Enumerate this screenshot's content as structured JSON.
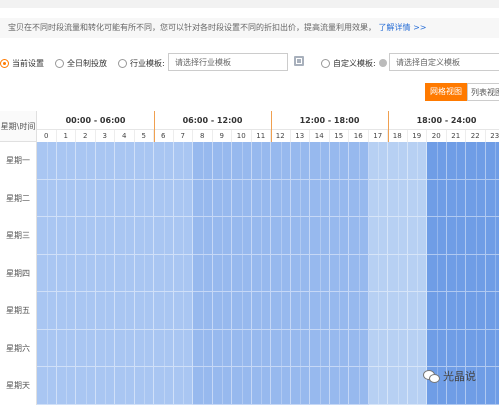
{
  "notice": {
    "text": "宝贝在不同时段流量和转化可能有所不同，您可以针对各时段设置不同的折扣出价，提高流量利用效果，",
    "link": "了解详情 >>"
  },
  "options": {
    "current": "当前设置",
    "full_day": "全日制投放",
    "industry": "行业模板:",
    "industry_placeholder": "请选择行业模板",
    "custom": "自定义模板:",
    "custom_placeholder": "请选择自定义模板",
    "selected": "current"
  },
  "view": {
    "grid": "网格视图",
    "list": "列表视图"
  },
  "grid": {
    "corner": "星期\\时间",
    "ranges": [
      "00:00 - 06:00",
      "06:00 - 12:00",
      "12:00 - 18:00",
      "18:00 - 24:00"
    ],
    "hours": [
      "0",
      "1",
      "2",
      "3",
      "4",
      "5",
      "6",
      "7",
      "8",
      "9",
      "10",
      "11",
      "12",
      "13",
      "14",
      "15",
      "16",
      "17",
      "18",
      "19",
      "20",
      "21",
      "22",
      "23"
    ],
    "days": [
      "星期一",
      "星期二",
      "星期三",
      "星期四",
      "星期五",
      "星期六",
      "星期天"
    ],
    "hour_levels": [
      2,
      2,
      2,
      2,
      2,
      2,
      2,
      2,
      3,
      3,
      3,
      3,
      3,
      3,
      3,
      3,
      3,
      1,
      1,
      1,
      4,
      4,
      4,
      4
    ],
    "colors": {
      "1": "#b7d0f3",
      "2": "#a9c6f2",
      "3": "#97b9ee",
      "4": "#6f9de6"
    }
  },
  "watermark": "光晶说"
}
